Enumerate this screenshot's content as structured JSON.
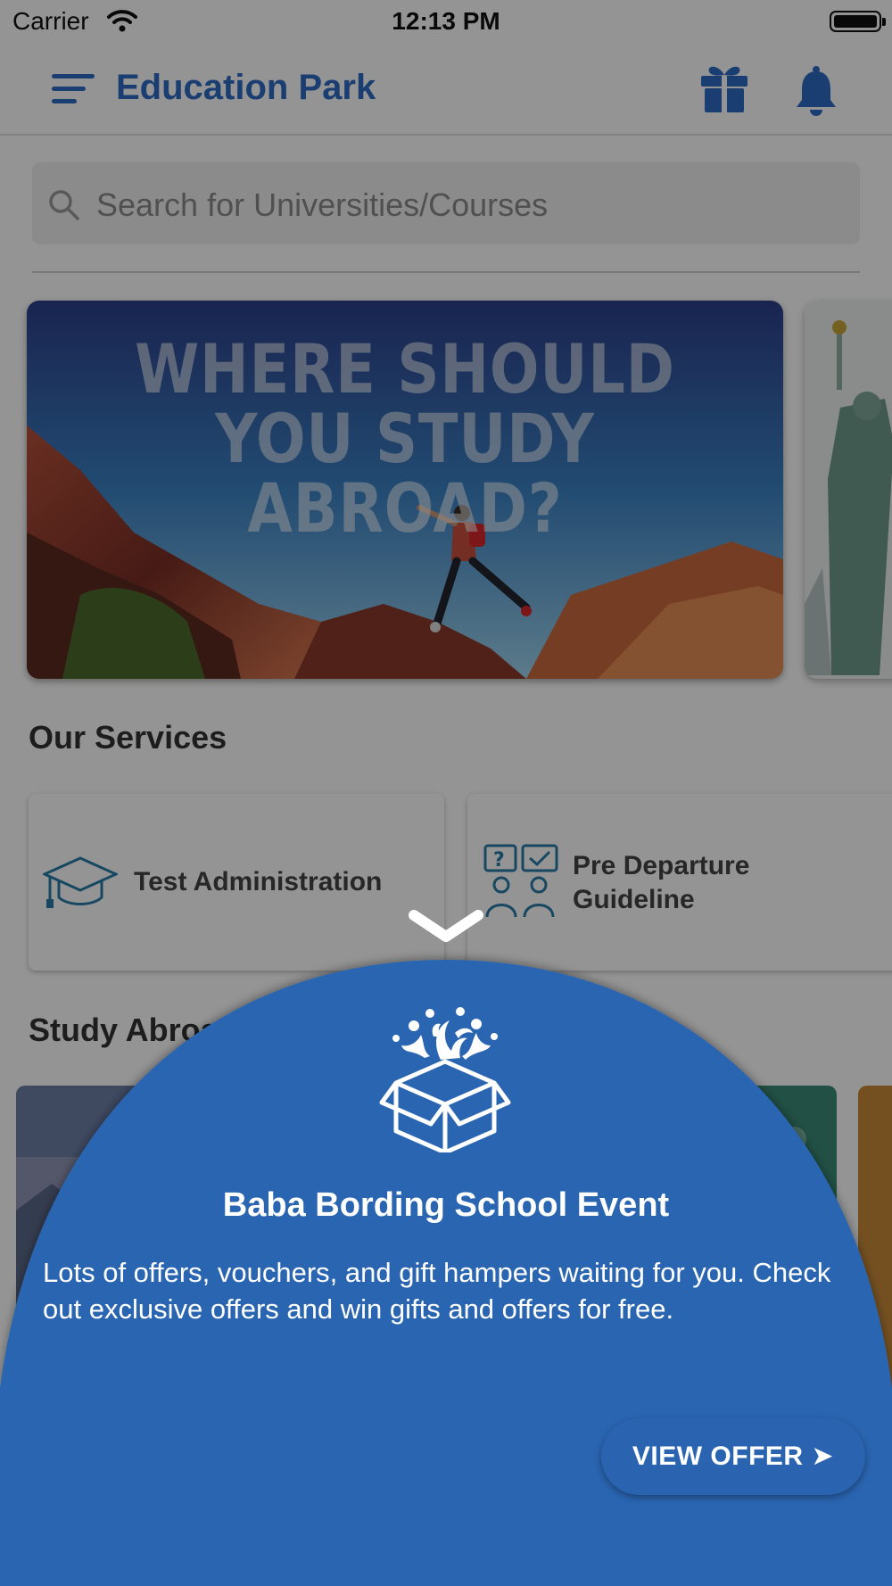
{
  "status_bar": {
    "carrier": "Carrier",
    "time": "12:13 PM"
  },
  "app_bar": {
    "title": "Education Park",
    "icons": [
      "menu-icon",
      "gift-icon",
      "bell-icon"
    ]
  },
  "search": {
    "placeholder": "Search for Universities/Courses"
  },
  "banners": [
    {
      "headline": "WHERE SHOULD YOU STUDY ABROAD?"
    }
  ],
  "services": {
    "title": "Our Services",
    "items": [
      {
        "label": "Test Administration",
        "icon": "graduation-cap-icon"
      },
      {
        "label_line1": "Pre Departure",
        "label_line2": "Guideline",
        "icon": "consultation-icon"
      }
    ]
  },
  "study_abroad": {
    "title_visible": "Study Abroa"
  },
  "offer_sheet": {
    "title": "Baba Bording School Event",
    "description": "Lots of offers, vouchers, and gift hampers waiting for you. Check out exclusive offers and win gifts and offers for free.",
    "button_label": "VIEW OFFER ➤",
    "icon": "gift-box-icon"
  },
  "colors": {
    "brand_blue": "#2d6bc4",
    "sheet_blue": "#2b65b1",
    "button_blue": "#2a64b0"
  }
}
